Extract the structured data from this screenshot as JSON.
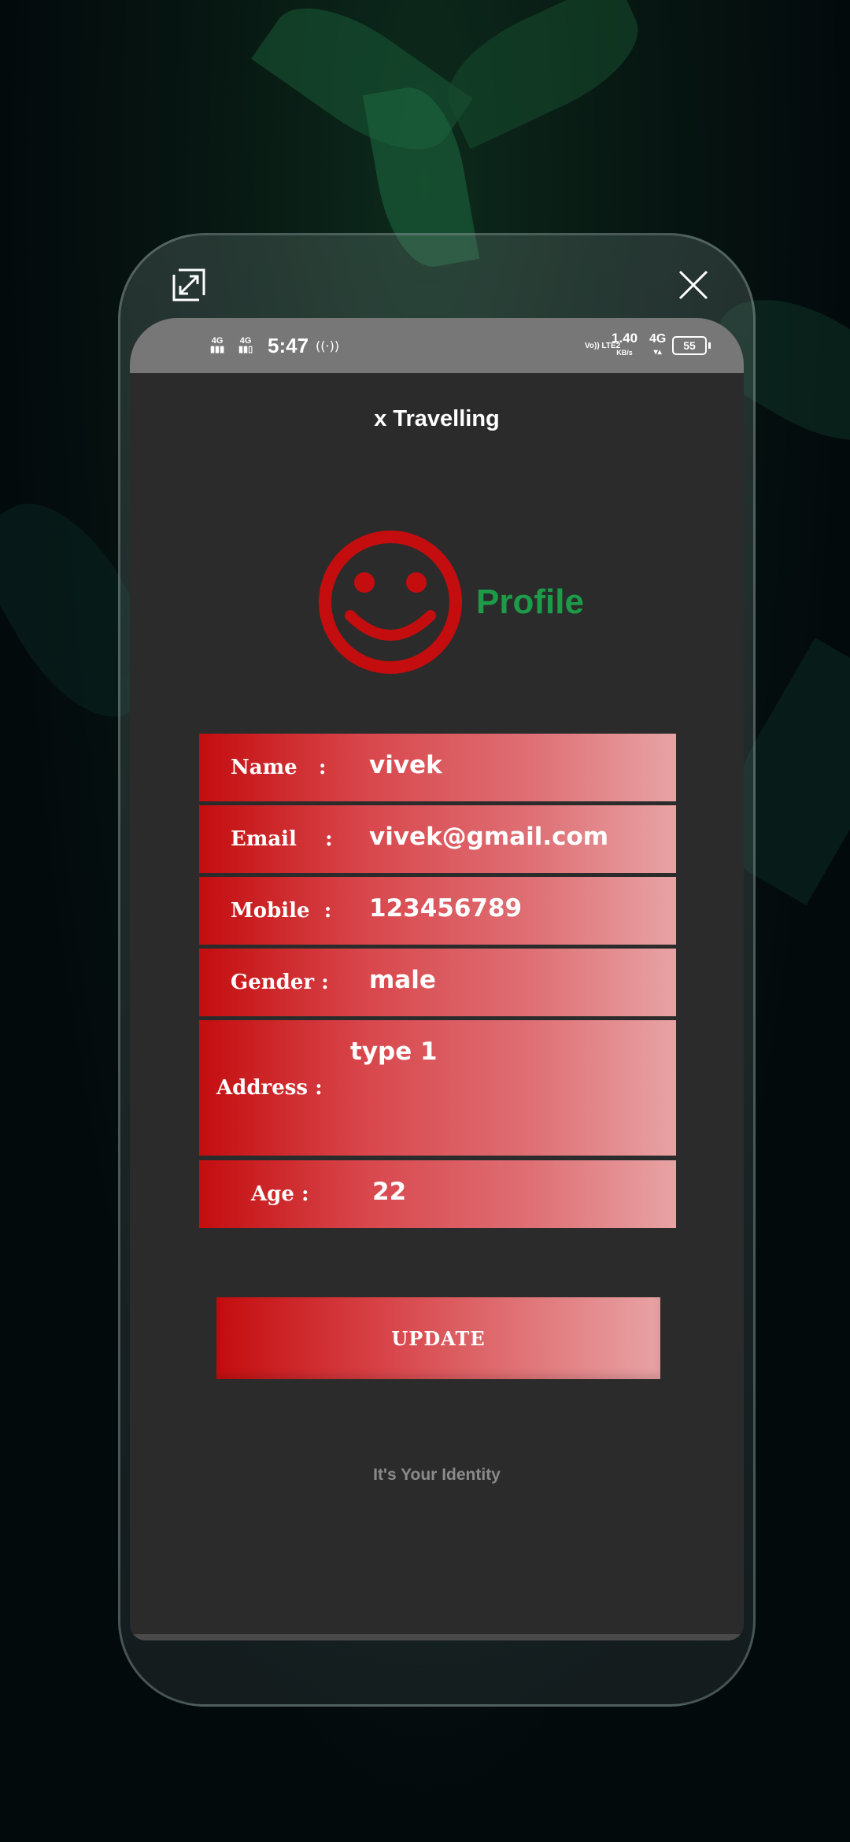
{
  "statusbar": {
    "sim1": "4G",
    "sim2": "4G",
    "time": "5:47",
    "volte": "Vo)) LTE2",
    "speed_value": "1.40",
    "speed_unit": "KB/s",
    "network": "4G",
    "battery": "55"
  },
  "app": {
    "title": "x Travelling",
    "profile_label": "Profile",
    "smiley_color": "#c40d0f",
    "accent_green": "#1c9b48"
  },
  "fields": {
    "name": {
      "label": "Name   :",
      "value": "vivek"
    },
    "email": {
      "label": "Email    :",
      "value": "vivek@gmail.com"
    },
    "mobile": {
      "label": "Mobile  :",
      "value": "123456789"
    },
    "gender": {
      "label": "Gender :",
      "value": "male"
    },
    "address": {
      "label": "Address :",
      "value": "type 1"
    },
    "age": {
      "label": "Age :",
      "value": "22"
    }
  },
  "update_button": "UPDATE",
  "footer_note": "It's Your Identity",
  "icons": {
    "expand": "expand-icon",
    "close": "close-icon",
    "hotspot": "hotspot-icon"
  }
}
